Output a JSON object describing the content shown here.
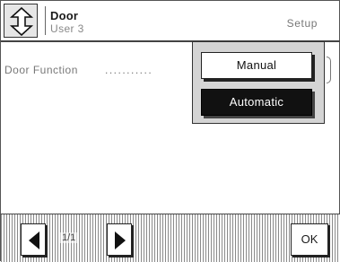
{
  "header": {
    "title": "Door",
    "user": "User 3",
    "mode": "Setup",
    "nav_icon": "up-down-arrow-icon"
  },
  "main": {
    "field_label": "Door Function",
    "field_dots": "..........."
  },
  "popup": {
    "options": [
      {
        "label": "Manual",
        "selected": false
      },
      {
        "label": "Automatic",
        "selected": true
      }
    ]
  },
  "footer": {
    "prev_icon": "left-triangle-icon",
    "next_icon": "right-triangle-icon",
    "page": "1/1",
    "ok_label": "OK"
  },
  "colors": {
    "background": "#ffffff",
    "text": "#1a1a1a",
    "selected_bg": "#111111",
    "selected_text": "#ffffff"
  }
}
